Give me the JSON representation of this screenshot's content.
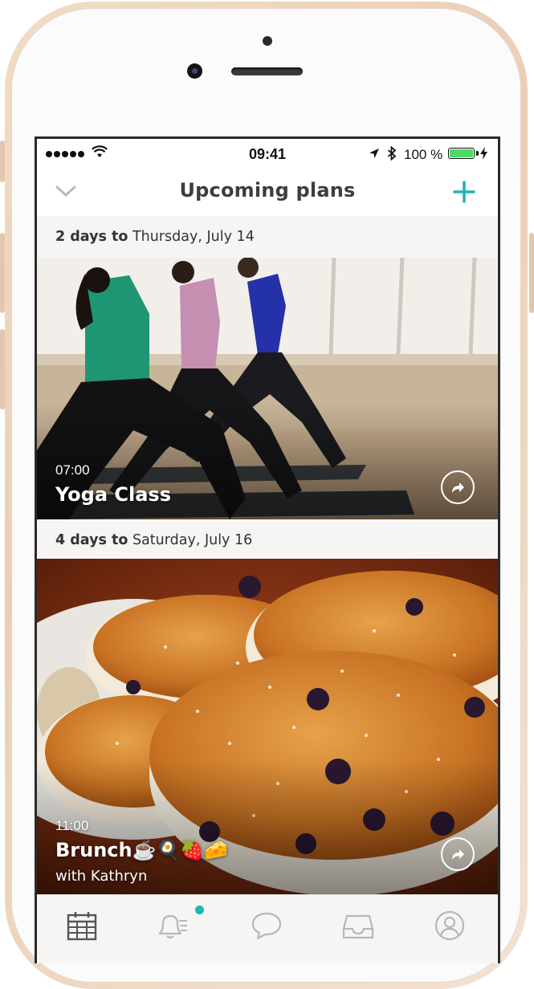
{
  "status_bar": {
    "signal_bars": 5,
    "time": "09:41",
    "battery_percent_text": "100 %",
    "battery_level": 1.0,
    "battery_color": "#4cd964"
  },
  "nav": {
    "title": "Upcoming plans",
    "back_icon": "chevron-down-icon",
    "add_icon": "plus-icon",
    "accent_color": "#1fb5b5"
  },
  "sections": [
    {
      "days": "2 days to",
      "date": "Thursday, July 14",
      "card": {
        "time": "07:00",
        "title": "Yoga Class",
        "subtitle": "",
        "share_icon": "share-icon"
      }
    },
    {
      "days": "4 days to",
      "date": "Saturday, July 16",
      "card": {
        "time": "11:00",
        "title": "Brunch☕️🍳🍓🧀",
        "subtitle": "with Kathryn",
        "share_icon": "share-icon"
      }
    }
  ],
  "tabbar": {
    "tabs": [
      {
        "icon": "calendar-icon",
        "active": true
      },
      {
        "icon": "notifications-icon",
        "active": false,
        "badge": true
      },
      {
        "icon": "chat-icon",
        "active": false
      },
      {
        "icon": "inbox-icon",
        "active": false
      },
      {
        "icon": "profile-icon",
        "active": false
      }
    ]
  }
}
